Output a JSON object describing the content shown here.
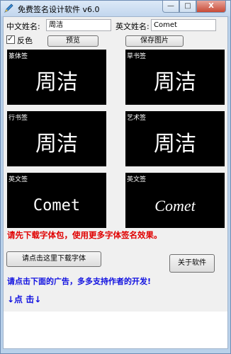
{
  "window": {
    "title": "免费签名设计软件  v6.0",
    "min_label": "—",
    "max_label": "□",
    "close_label": "X"
  },
  "form": {
    "cn_label": "中文姓名:",
    "cn_value": "周洁",
    "en_label": "英文姓名:",
    "en_value": "Comet",
    "invert_label": "反色",
    "invert_checked": true
  },
  "buttons": {
    "preview": "预览",
    "save_image": "保存图片",
    "download_fonts": "请点击这里下载字体",
    "about": "关于软件"
  },
  "panels": [
    {
      "label": "篆体签",
      "text": "周洁"
    },
    {
      "label": "草书签",
      "text": "周洁"
    },
    {
      "label": "行书签",
      "text": "周洁"
    },
    {
      "label": "艺术签",
      "text": "周洁"
    },
    {
      "label": "英文签",
      "text": "Comet"
    },
    {
      "label": "英文签",
      "text": "Comet"
    }
  ],
  "notes": {
    "red": "请先下载字体包，使用更多字体签名效果。",
    "blue": "请点击下面的广告，多多支持作者的开发!",
    "arrows": "↓点 击↓"
  },
  "colors": {
    "red_note": "#e00000",
    "blue_note": "#1010e0",
    "panel_bg": "#000000"
  }
}
